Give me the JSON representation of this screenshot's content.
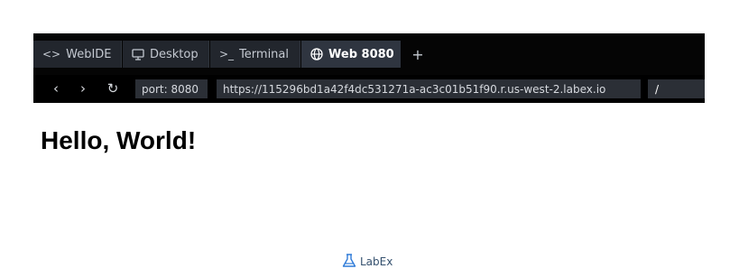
{
  "tabs": [
    {
      "icon": "code-icon",
      "label": "WebIDE",
      "active": false
    },
    {
      "icon": "monitor-icon",
      "label": "Desktop",
      "active": false
    },
    {
      "icon": "terminal-icon",
      "label": "Terminal",
      "active": false
    },
    {
      "icon": "globe-icon",
      "label": "Web 8080",
      "active": true
    }
  ],
  "tab_add_label": "+",
  "nav": {
    "back_glyph": "‹",
    "forward_glyph": "›",
    "reload_glyph": "↻",
    "port_label": "port: 8080",
    "url": "https://115296bd1a42f4dc531271a-ac3c01b51f90.r.us-west-2.labex.io",
    "path": "/"
  },
  "page": {
    "heading": "Hello, World!"
  },
  "footer": {
    "brand_name": "LabEx"
  },
  "colors": {
    "chrome_bg": "#000000",
    "tab_bg": "#22262d",
    "tab_active_bg": "#2f3540",
    "brand": "#34506e"
  }
}
